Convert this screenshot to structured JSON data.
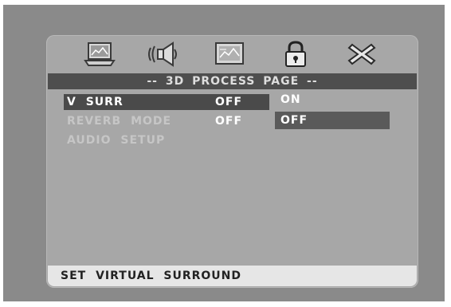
{
  "header": {
    "icons": [
      "general-setup-icon",
      "audio-setup-icon",
      "video-setup-icon",
      "lock-icon",
      "exit-icon"
    ],
    "title": "-- 3D PROCESS PAGE --"
  },
  "menu": {
    "items": [
      {
        "label": "V SURR",
        "value": "OFF",
        "selected": true
      },
      {
        "label": "REVERB MODE",
        "value": "OFF",
        "selected": false
      },
      {
        "label": "AUDIO SETUP",
        "value": "",
        "selected": false
      }
    ]
  },
  "options": {
    "items": [
      {
        "label": "ON",
        "selected": false
      },
      {
        "label": "OFF",
        "selected": true
      }
    ]
  },
  "status": {
    "text": "SET VIRTUAL SURROUND"
  },
  "colors": {
    "screen_background": "#8a8a8a",
    "panel_background": "#a7a7a7",
    "title_bar": "#4e4e4e",
    "highlight": "#4a4a4a",
    "status_bar": "#e6e6e6"
  }
}
